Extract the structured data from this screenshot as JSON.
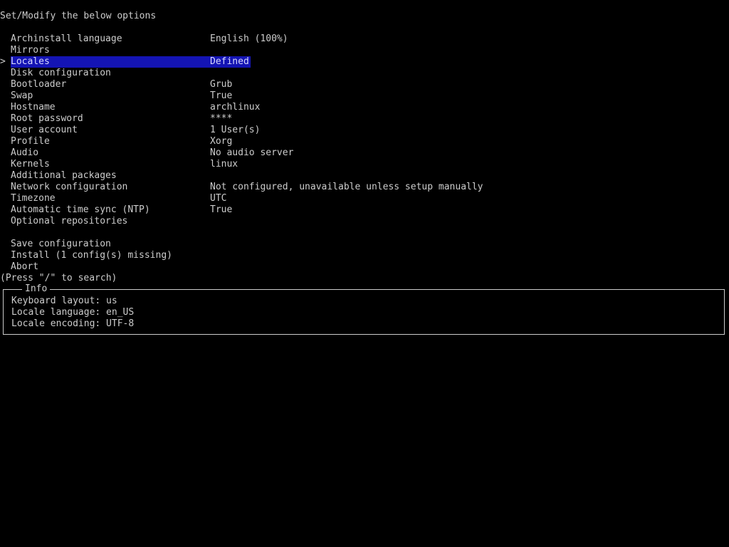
{
  "header": {
    "title": "Set/Modify the below options"
  },
  "menu": {
    "cursor_glyph": ">",
    "items": [
      {
        "label": "Archinstall language",
        "value": "English (100%)"
      },
      {
        "label": "Mirrors",
        "value": ""
      },
      {
        "label": "Locales",
        "value": "Defined",
        "selected": true
      },
      {
        "label": "Disk configuration",
        "value": ""
      },
      {
        "label": "Bootloader",
        "value": "Grub"
      },
      {
        "label": "Swap",
        "value": "True"
      },
      {
        "label": "Hostname",
        "value": "archlinux"
      },
      {
        "label": "Root password",
        "value": "****"
      },
      {
        "label": "User account",
        "value": "1 User(s)"
      },
      {
        "label": "Profile",
        "value": "Xorg"
      },
      {
        "label": "Audio",
        "value": "No audio server"
      },
      {
        "label": "Kernels",
        "value": "linux"
      },
      {
        "label": "Additional packages",
        "value": ""
      },
      {
        "label": "Network configuration",
        "value": "Not configured, unavailable unless setup manually"
      },
      {
        "label": "Timezone",
        "value": "UTC"
      },
      {
        "label": "Automatic time sync (NTP)",
        "value": "True"
      },
      {
        "label": "Optional repositories",
        "value": ""
      }
    ],
    "actions": [
      {
        "label": "Save configuration"
      },
      {
        "label": "Install (1 config(s) missing)"
      },
      {
        "label": "Abort"
      }
    ]
  },
  "search_hint": "(Press \"/\" to search)",
  "info": {
    "title": "Info",
    "lines": [
      "Keyboard layout: us",
      "Locale language: en_US",
      "Locale encoding: UTF-8"
    ]
  },
  "colors": {
    "background": "#000000",
    "text": "#cccccc",
    "selection": "#1414b4"
  }
}
